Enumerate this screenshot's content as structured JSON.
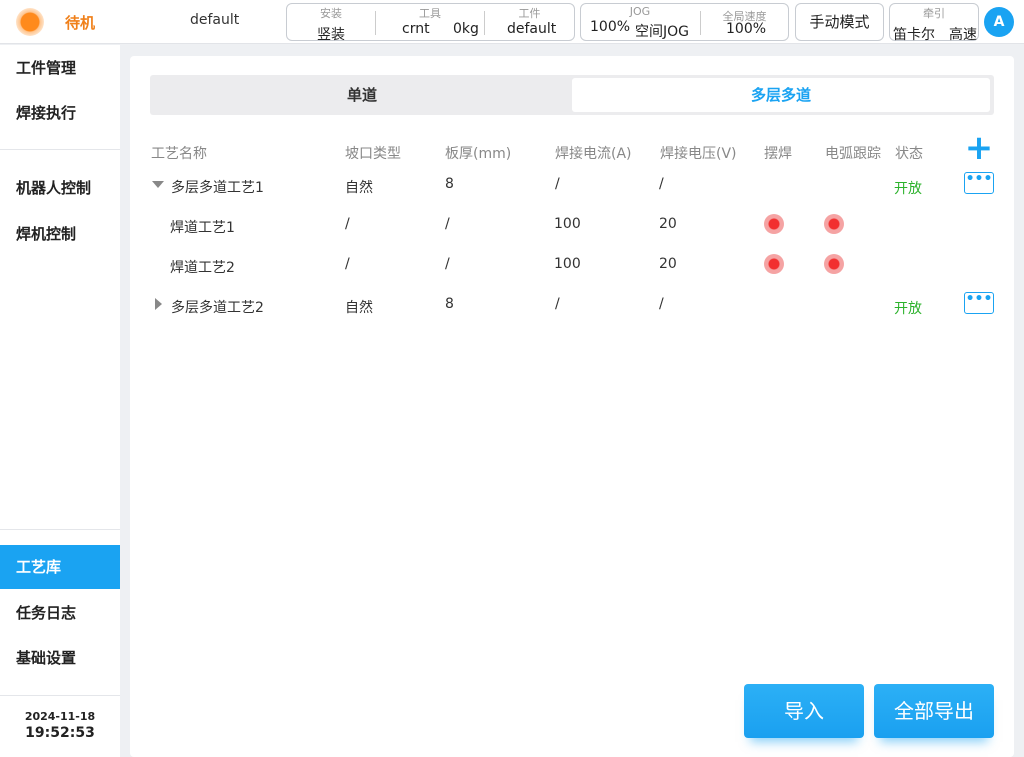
{
  "topbar": {
    "status": "待机",
    "program": "default",
    "install": {
      "caption": "安装",
      "value": "竖装"
    },
    "tool": {
      "caption": "工具",
      "name": "crnt",
      "weight": "0kg"
    },
    "workpiece": {
      "caption": "工件",
      "value": "default"
    },
    "jog": {
      "caption": "JOG",
      "percent": "100%",
      "mode": "空间JOG"
    },
    "global_speed": {
      "caption": "全局速度",
      "value": "100%"
    },
    "manual_mode": "手动模式",
    "traction": {
      "caption": "牵引",
      "coord": "笛卡尔",
      "speed": "高速"
    },
    "avatar": "A"
  },
  "sidebar": {
    "items": [
      {
        "label": "工件管理"
      },
      {
        "label": "焊接执行"
      },
      {
        "label": "机器人控制"
      },
      {
        "label": "焊机控制"
      },
      {
        "label": "工艺库"
      },
      {
        "label": "任务日志"
      },
      {
        "label": "基础设置"
      }
    ],
    "date": "2024-11-18",
    "time": "19:52:53"
  },
  "tabs": {
    "single": "单道",
    "multi": "多层多道"
  },
  "table": {
    "headers": [
      "工艺名称",
      "坡口类型",
      "板厚(mm)",
      "焊接电流(A)",
      "焊接电压(V)",
      "摆焊",
      "电弧跟踪",
      "状态"
    ],
    "rows": [
      {
        "name": "多层多道工艺1",
        "groove": "自然",
        "thickness": "8",
        "current": "/",
        "voltage": "/",
        "status": "开放"
      },
      {
        "name": "焊道工艺1",
        "groove": "/",
        "thickness": "/",
        "current": "100",
        "voltage": "20"
      },
      {
        "name": "焊道工艺2",
        "groove": "/",
        "thickness": "/",
        "current": "100",
        "voltage": "20"
      },
      {
        "name": "多层多道工艺2",
        "groove": "自然",
        "thickness": "8",
        "current": "/",
        "voltage": "/",
        "status": "开放"
      }
    ],
    "more": "•••",
    "add": "+"
  },
  "actions": {
    "import": "导入",
    "export_all": "全部导出"
  },
  "colors": {
    "accent": "#1aa3f2",
    "status_orange": "#f0801a",
    "open_green": "#2cb22c",
    "led_red": "#f23030"
  }
}
